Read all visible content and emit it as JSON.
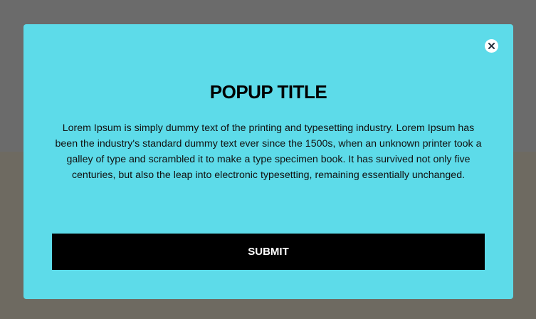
{
  "popup": {
    "title": "POPUP TITLE",
    "body": "Lorem Ipsum is simply dummy text of the printing and typesetting industry. Lorem Ipsum has been the industry's standard dummy text ever since the 1500s, when an unknown printer took a galley of type and scrambled it to make a type specimen book. It has survived not only five centuries, but also the leap into electronic typesetting, remaining essentially unchanged.",
    "submit_label": "SUBMIT",
    "close_icon": "close-icon"
  },
  "colors": {
    "popup_background": "#5ddbe9",
    "overlay_top": "#6b6b6b",
    "overlay_bottom": "#6e6a61",
    "button_background": "#000000",
    "button_text": "#ffffff"
  }
}
